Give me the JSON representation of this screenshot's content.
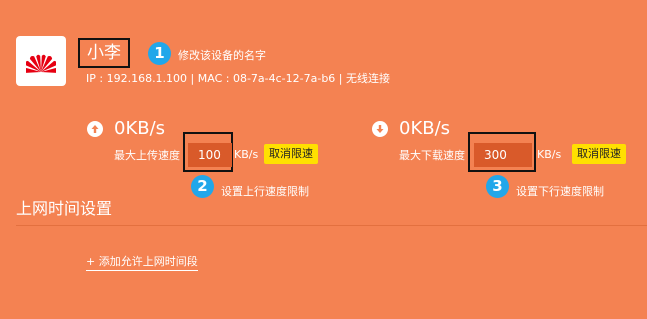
{
  "device": {
    "brand_icon": "huawei-logo",
    "name": "小李",
    "info": "IP : 192.168.1.100 | MAC : 08-7a-4c-12-7a-b6 | 无线连接"
  },
  "annotations": [
    {
      "number": "1",
      "text": "修改该设备的名字"
    },
    {
      "number": "2",
      "text": "设置上行速度限制"
    },
    {
      "number": "3",
      "text": "设置下行速度限制"
    }
  ],
  "upload": {
    "icon": "arrow-up-icon",
    "speed": "0KB/s",
    "limit_label": "最大上传速度",
    "limit_value": "100",
    "unit": "KB/s",
    "cancel_label": "取消限速"
  },
  "download": {
    "icon": "arrow-down-icon",
    "speed": "0KB/s",
    "limit_label": "最大下载速度",
    "limit_value": "300",
    "unit": "KB/s",
    "cancel_label": "取消限速"
  },
  "schedule": {
    "title": "上网时间设置",
    "add_label": "+ 添加允许上网时间段"
  },
  "colors": {
    "background": "#f48252",
    "callout": "#21a7ea",
    "button": "#ffe000",
    "brand": "#e60012"
  }
}
